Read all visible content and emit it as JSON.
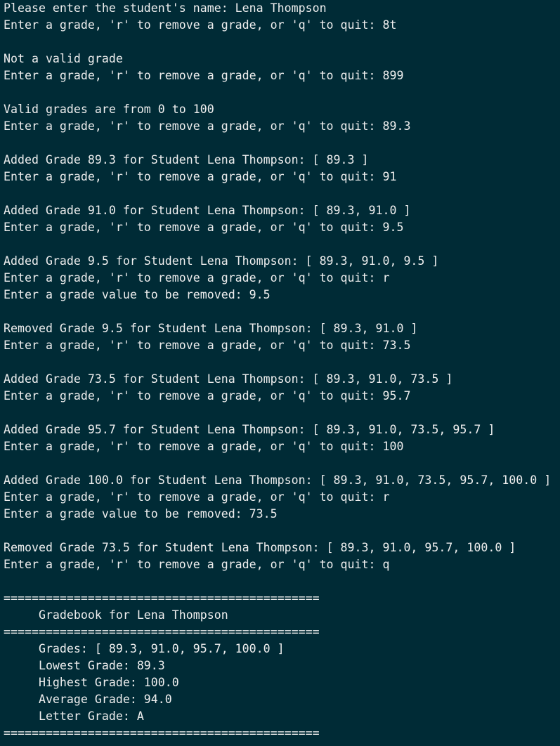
{
  "terminal": {
    "lines": [
      "Please enter the student's name: Lena Thompson",
      "Enter a grade, 'r' to remove a grade, or 'q' to quit: 8t",
      "",
      "Not a valid grade",
      "Enter a grade, 'r' to remove a grade, or 'q' to quit: 899",
      "",
      "Valid grades are from 0 to 100",
      "Enter a grade, 'r' to remove a grade, or 'q' to quit: 89.3",
      "",
      "Added Grade 89.3 for Student Lena Thompson: [ 89.3 ]",
      "Enter a grade, 'r' to remove a grade, or 'q' to quit: 91",
      "",
      "Added Grade 91.0 for Student Lena Thompson: [ 89.3, 91.0 ]",
      "Enter a grade, 'r' to remove a grade, or 'q' to quit: 9.5",
      "",
      "Added Grade 9.5 for Student Lena Thompson: [ 89.3, 91.0, 9.5 ]",
      "Enter a grade, 'r' to remove a grade, or 'q' to quit: r",
      "Enter a grade value to be removed: 9.5",
      "",
      "Removed Grade 9.5 for Student Lena Thompson: [ 89.3, 91.0 ]",
      "Enter a grade, 'r' to remove a grade, or 'q' to quit: 73.5",
      "",
      "Added Grade 73.5 for Student Lena Thompson: [ 89.3, 91.0, 73.5 ]",
      "Enter a grade, 'r' to remove a grade, or 'q' to quit: 95.7",
      "",
      "Added Grade 95.7 for Student Lena Thompson: [ 89.3, 91.0, 73.5, 95.7 ]",
      "Enter a grade, 'r' to remove a grade, or 'q' to quit: 100",
      "",
      "Added Grade 100.0 for Student Lena Thompson: [ 89.3, 91.0, 73.5, 95.7, 100.0 ]",
      "Enter a grade, 'r' to remove a grade, or 'q' to quit: r",
      "Enter a grade value to be removed: 73.5",
      "",
      "Removed Grade 73.5 for Student Lena Thompson: [ 89.3, 91.0, 95.7, 100.0 ]",
      "Enter a grade, 'r' to remove a grade, or 'q' to quit: q",
      "",
      "=============================================",
      "     Gradebook for Lena Thompson",
      "=============================================",
      "     Grades: [ 89.3, 91.0, 95.7, 100.0 ]",
      "     Lowest Grade: 89.3",
      "     Highest Grade: 100.0",
      "     Average Grade: 94.0",
      "     Letter Grade: A",
      "============================================="
    ]
  }
}
